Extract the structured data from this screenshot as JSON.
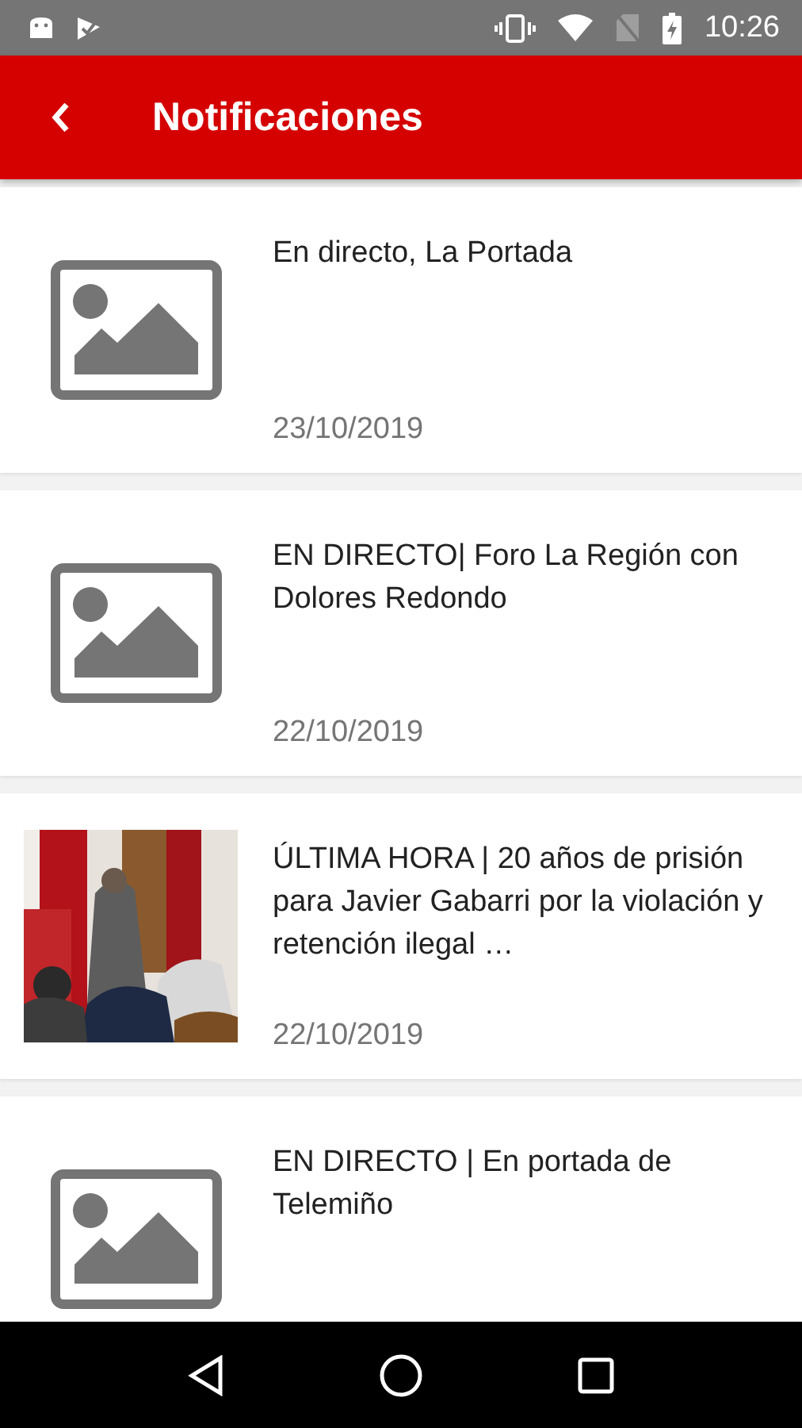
{
  "status_bar": {
    "time": "10:26"
  },
  "header": {
    "title": "Notificaciones"
  },
  "notifications": [
    {
      "kind": "placeholder",
      "title": "En directo, La Portada",
      "date": "23/10/2019"
    },
    {
      "kind": "placeholder",
      "title": "EN DIRECTO| Foro La Región con Dolores Redondo",
      "date": "22/10/2019"
    },
    {
      "title": "ÚLTIMA HORA | 20 años de prisión para Javier Gabarri por la violación y retención ilegal …",
      "date": "22/10/2019"
    },
    {
      "kind": "placeholder",
      "title": "EN DIRECTO | En portada de Telemiño"
    }
  ]
}
